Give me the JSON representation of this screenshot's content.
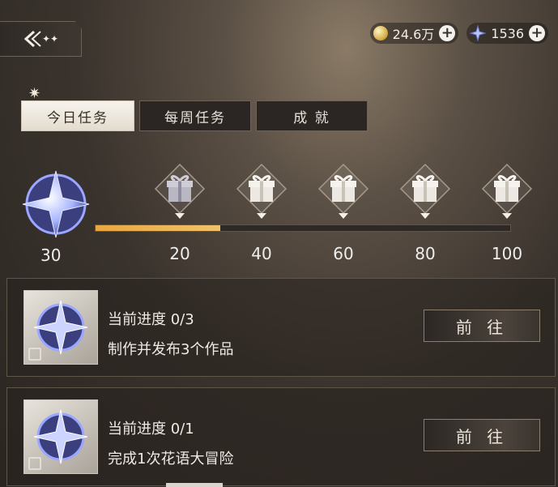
{
  "header": {
    "back_icon": "back-arrow-sparkle-icon",
    "coins": "24.6万",
    "stars": "1536"
  },
  "tabs": [
    {
      "label": "今日任务",
      "active": true
    },
    {
      "label": "每周任务",
      "active": false
    },
    {
      "label": "成 就",
      "active": false
    }
  ],
  "progress": {
    "current_stars": "30",
    "fill_fraction": 0.3,
    "milestones": [
      "20",
      "40",
      "60",
      "80",
      "100"
    ]
  },
  "tasks": [
    {
      "progress_label": "当前进度",
      "progress_value": "0/3",
      "desc": "制作并发布3个作品",
      "button": "前 往"
    },
    {
      "progress_label": "当前进度",
      "progress_value": "0/1",
      "desc": "完成1次花语大冒险",
      "button": "前 往"
    }
  ],
  "colors": {
    "accent": "#e8a640",
    "background": "#3a332d"
  }
}
